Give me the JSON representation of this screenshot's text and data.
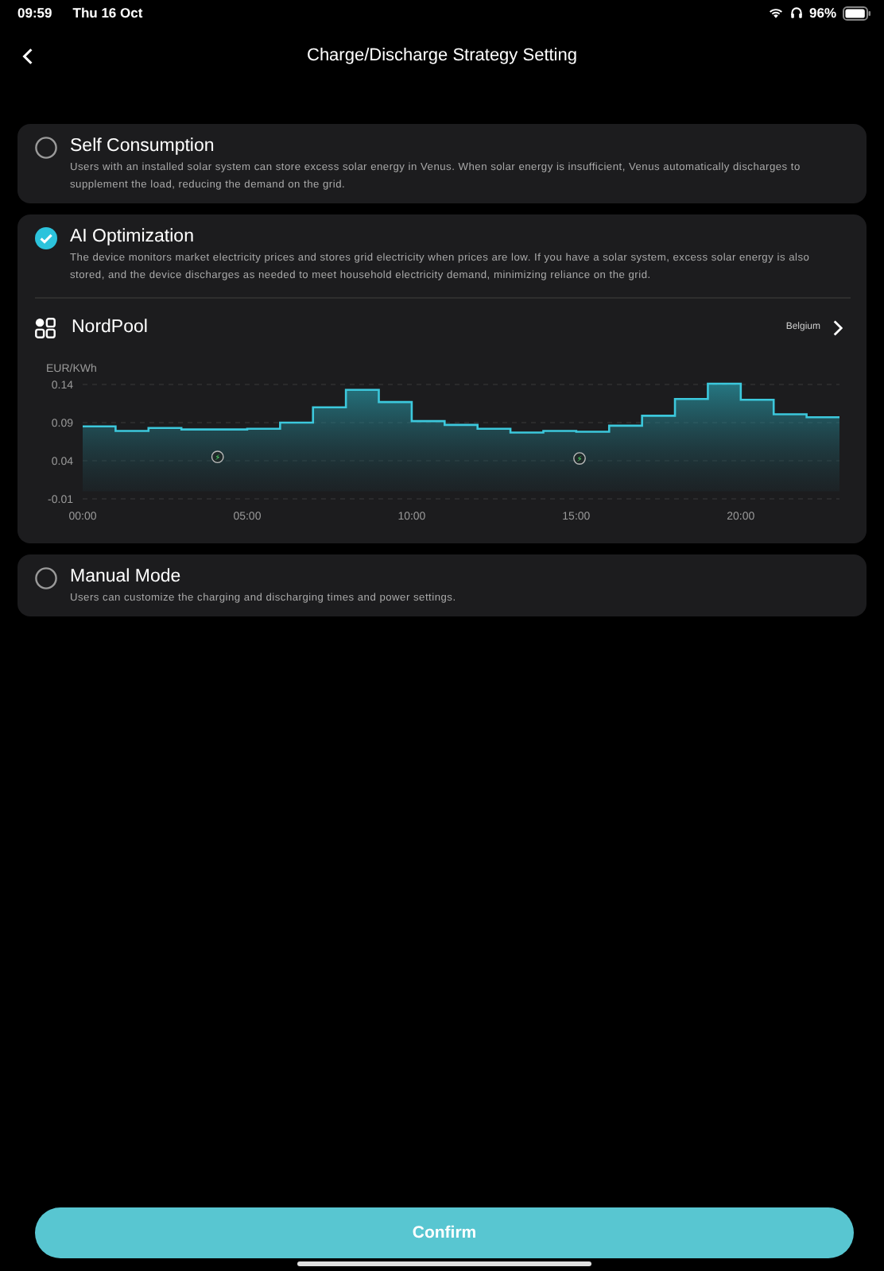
{
  "status_bar": {
    "time": "09:59",
    "date": "Thu 16 Oct",
    "battery": "96%"
  },
  "header": {
    "title": "Charge/Discharge Strategy Setting"
  },
  "options": [
    {
      "title": "Self Consumption",
      "description": "Users with an installed solar system can store excess solar energy in Venus. When solar energy is insufficient, Venus automatically discharges to supplement the load, reducing the demand on the grid.",
      "selected": false
    },
    {
      "title": "AI Optimization",
      "description": "The device monitors market electricity prices and stores grid electricity when prices are low. If you have a solar system, excess solar energy is also stored, and the device discharges as needed to meet household electricity demand, minimizing reliance on the grid.",
      "selected": true,
      "provider": {
        "name": "NordPool",
        "region": "Belgium"
      },
      "chart_data": {
        "type": "area",
        "ylabel": "EUR/KWh",
        "x": [
          0,
          1,
          1,
          2,
          2,
          3,
          3,
          4,
          4,
          5,
          5,
          6,
          6,
          7,
          7,
          8,
          8,
          9,
          9,
          10,
          10,
          11,
          11,
          12,
          12,
          13,
          13,
          14,
          14,
          15,
          15,
          16,
          16,
          17,
          17,
          18,
          18,
          19,
          19,
          20,
          20,
          21,
          21,
          22,
          22,
          23
        ],
        "series": [
          {
            "color": "#3cc8dc",
            "values": [
              0.085,
              0.085,
              0.079,
              0.079,
              0.083,
              0.083,
              0.081,
              0.081,
              0.081,
              0.081,
              0.082,
              0.082,
              0.09,
              0.09,
              0.11,
              0.11,
              0.133,
              0.133,
              0.117,
              0.117,
              0.092,
              0.092,
              0.087,
              0.087,
              0.082,
              0.082,
              0.077,
              0.077,
              0.079,
              0.079,
              0.078,
              0.078,
              0.086,
              0.086,
              0.099,
              0.099,
              0.121,
              0.121,
              0.141,
              0.141,
              0.12,
              0.12,
              0.101,
              0.101,
              0.097,
              0.097
            ]
          }
        ],
        "xlim": [
          0,
          23
        ],
        "ylim": [
          -0.01,
          0.145
        ],
        "xticks": [
          {
            "value": 0,
            "label": "00:00"
          },
          {
            "value": 5,
            "label": "05:00"
          },
          {
            "value": 10,
            "label": "10:00"
          },
          {
            "value": 15,
            "label": "15:00"
          },
          {
            "value": 20,
            "label": "20:00"
          }
        ],
        "yticks": [
          {
            "value": 0.14,
            "label": "0.14"
          },
          {
            "value": 0.09,
            "label": "0.09"
          },
          {
            "value": 0.04,
            "label": "0.04"
          },
          {
            "value": -0.01,
            "label": "-0.01"
          }
        ],
        "annotations": [
          {
            "x": 4.1,
            "y": 0.045,
            "text": "⚡"
          },
          {
            "x": 15.1,
            "y": 0.043,
            "text": "⚡"
          }
        ]
      }
    },
    {
      "title": "Manual Mode",
      "description": "Users can customize the charging and discharging times and power settings.",
      "selected": false
    }
  ],
  "confirm_button": {
    "label": "Confirm"
  }
}
